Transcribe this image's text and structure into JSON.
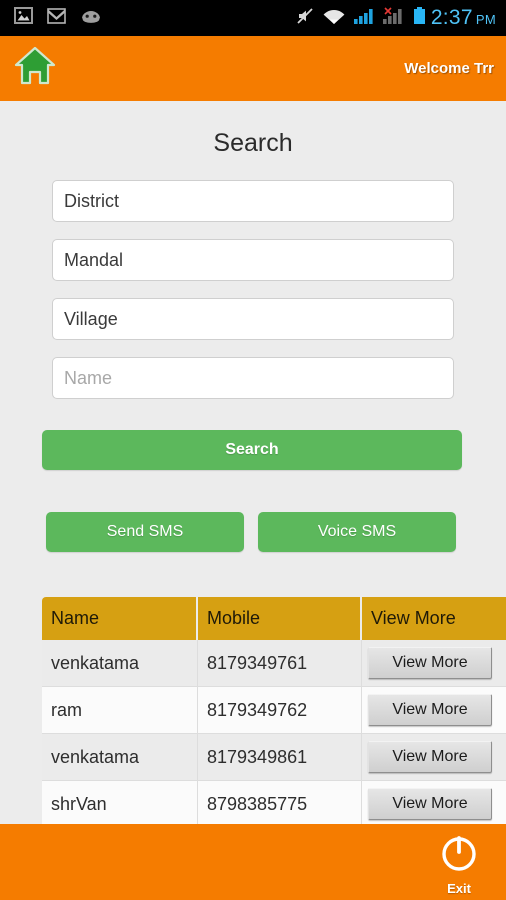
{
  "statusbar": {
    "icons_left": [
      "gallery-icon",
      "gmail-icon",
      "android-head-icon"
    ],
    "icons_right": [
      "mute-icon",
      "wifi-icon",
      "signal-icon",
      "signal-no-sim-icon",
      "battery-icon"
    ],
    "time": "2:37",
    "ampm": "PM",
    "clock_color": "#4fc3f7"
  },
  "appbar": {
    "home_icon": "home-icon",
    "welcome_text": "Welcome Trr",
    "background_color": "#f57c00"
  },
  "main": {
    "title": "Search",
    "fields": [
      {
        "name": "district",
        "value": "District",
        "placeholder": "District",
        "is_placeholder": false
      },
      {
        "name": "mandal",
        "value": "Mandal",
        "placeholder": "Mandal",
        "is_placeholder": false
      },
      {
        "name": "village",
        "value": "Village",
        "placeholder": "Village",
        "is_placeholder": false
      },
      {
        "name": "name",
        "value": "",
        "placeholder": "Name",
        "is_placeholder": true
      }
    ],
    "search_button": "Search",
    "send_sms_button": "Send SMS",
    "voice_sms_button": "Voice SMS",
    "button_color": "#5cb85c"
  },
  "table": {
    "header_color": "#d6a012",
    "columns": [
      "Name",
      "Mobile",
      "View More"
    ],
    "rows": [
      {
        "name": "venkatama",
        "mobile": "8179349761",
        "action": "View More"
      },
      {
        "name": "ram",
        "mobile": "8179349762",
        "action": "View More"
      },
      {
        "name": "venkatama",
        "mobile": "8179349861",
        "action": "View More"
      },
      {
        "name": "shrVan",
        "mobile": "8798385775",
        "action": "View More"
      }
    ]
  },
  "footer": {
    "exit_icon": "power-icon",
    "exit_label": "Exit",
    "background_color": "#f57c00"
  }
}
